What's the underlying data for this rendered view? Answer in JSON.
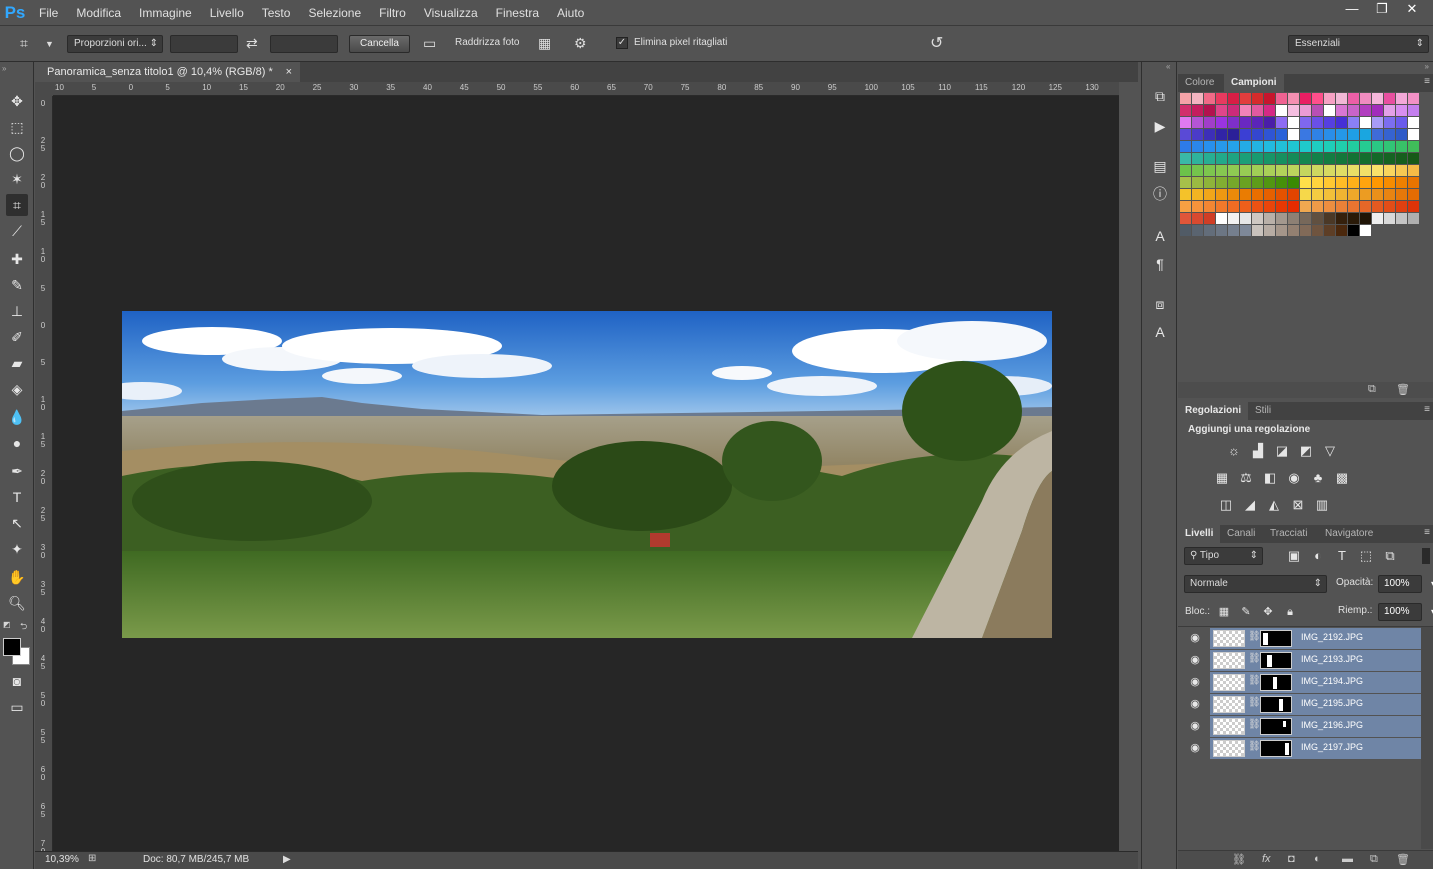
{
  "app": {
    "logo": "Ps"
  },
  "menu": [
    "File",
    "Modifica",
    "Immagine",
    "Livello",
    "Testo",
    "Selezione",
    "Filtro",
    "Visualizza",
    "Finestra",
    "Aiuto"
  ],
  "window_controls": {
    "minimize": "—",
    "restore": "❐",
    "close": "✕"
  },
  "options_bar": {
    "ratio_select": "Proporzioni ori...",
    "width_value": "",
    "height_value": "",
    "clear_button": "Cancella",
    "straighten_label": "Raddrizza foto",
    "delete_cropped_label": "Elimina pixel ritagliati",
    "delete_cropped_checked": true,
    "workspace_select": "Essenziali"
  },
  "document": {
    "tab_title": "Panoramica_senza titolo1 @ 10,4% (RGB/8) *",
    "tab_close": "×",
    "ruler_top": [
      "10",
      "5",
      "0",
      "5",
      "10",
      "15",
      "20",
      "25",
      "30",
      "35",
      "40",
      "45",
      "50",
      "55",
      "60",
      "65",
      "70",
      "75",
      "80",
      "85",
      "90",
      "95",
      "100",
      "105",
      "110",
      "115",
      "120",
      "125",
      "130"
    ],
    "ruler_left": [
      "0",
      "25",
      "20",
      "15",
      "10",
      "5",
      "0",
      "5",
      "10",
      "15",
      "20",
      "25",
      "30",
      "35",
      "40",
      "45",
      "50",
      "55",
      "60",
      "65",
      "70"
    ],
    "zoom": "10,39%",
    "doc_info": "Doc: 80,7 MB/245,7 MB"
  },
  "panels": {
    "swatches_tabs": [
      "Colore",
      "Campioni"
    ],
    "adjustments_tabs": [
      "Regolazioni",
      "Stili"
    ],
    "adjustments_heading": "Aggiungi una regolazione",
    "layers_tabs": [
      "Livelli",
      "Canali",
      "Tracciati",
      "Navigatore"
    ],
    "layers_filter": "Tipo",
    "blend_mode": "Normale",
    "opacity_label": "Opacità:",
    "opacity_value": "100%",
    "lock_label": "Bloc.:",
    "fill_label": "Riemp.:",
    "fill_value": "100%",
    "layers": [
      {
        "name": "IMG_2192.JPG"
      },
      {
        "name": "IMG_2193.JPG"
      },
      {
        "name": "IMG_2194.JPG"
      },
      {
        "name": "IMG_2195.JPG"
      },
      {
        "name": "IMG_2196.JPG"
      },
      {
        "name": "IMG_2197.JPG"
      }
    ]
  },
  "colors": {
    "selection": "#6f85a6",
    "canvas_bg": "#262626",
    "ui_bg": "#535353"
  }
}
